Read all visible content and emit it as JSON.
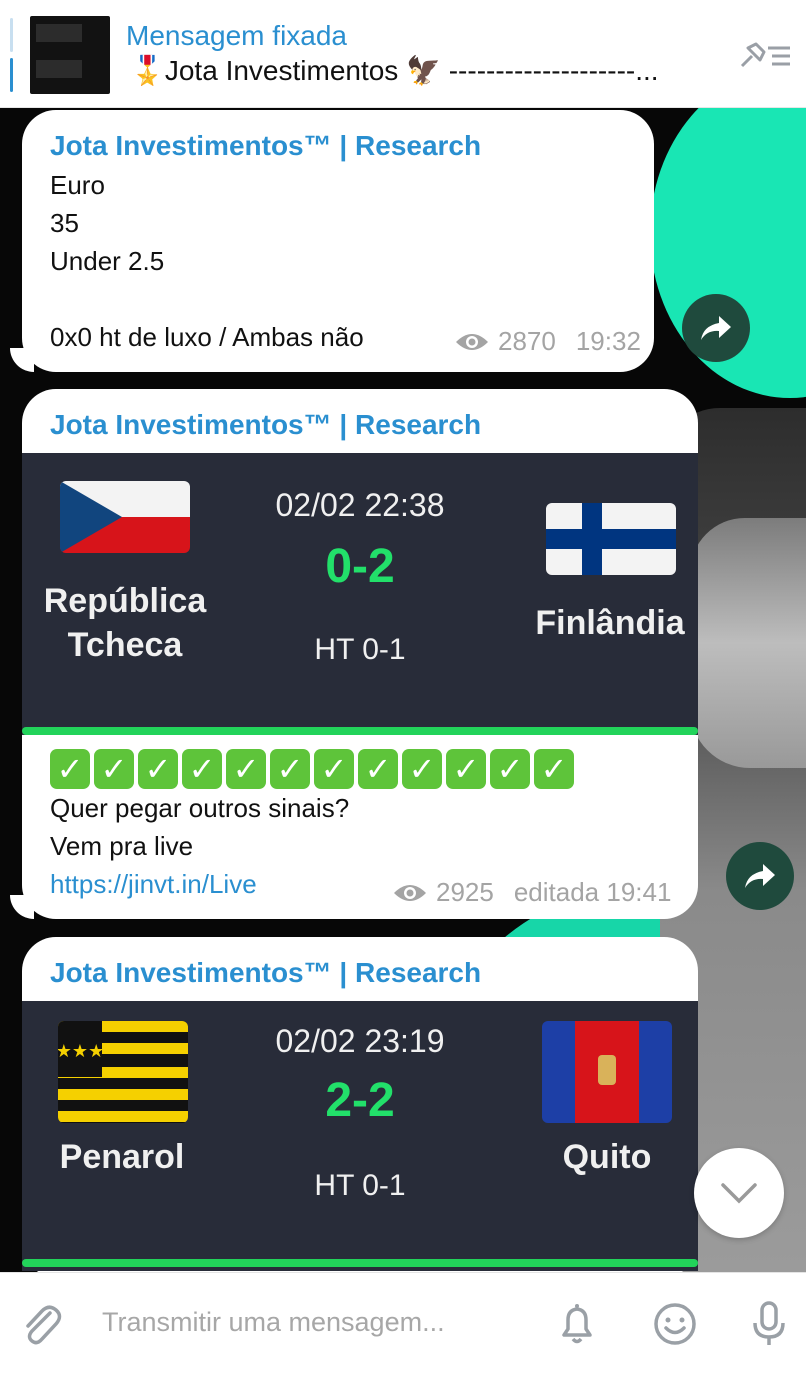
{
  "pinned": {
    "title": "Mensagem fixada",
    "text": "🎖️Jota Investimentos 🦅  --------------------..."
  },
  "messages": [
    {
      "sender": "Jota Investimentos™ | Research",
      "lines": [
        "Euro",
        "35",
        "Under 2.5",
        "",
        "0x0 ht de luxo / Ambas não"
      ],
      "views": "2870",
      "time": "19:32"
    },
    {
      "sender": "Jota Investimentos™ | Research",
      "match": {
        "home": "República\nTcheca",
        "away": "Finlândia",
        "datetime": "02/02 22:38",
        "score": "0-2",
        "halftime": "HT 0-1"
      },
      "checks_count": 12,
      "lines": [
        "Quer pegar outros sinais?",
        "Vem pra live"
      ],
      "link": "https://jinvt.in/Live",
      "views": "2925",
      "time": "editada 19:41"
    },
    {
      "sender": "Jota Investimentos™ | Research",
      "match": {
        "home": "Penarol",
        "away": "Quito",
        "datetime": "02/02 23:19",
        "score": "2-2",
        "halftime": "HT 0-1"
      }
    }
  ],
  "input": {
    "placeholder": "Transmitir uma mensagem..."
  },
  "colors": {
    "accent": "#2a8fd0",
    "score_green": "#22e06a",
    "card_bg": "#282c39"
  }
}
